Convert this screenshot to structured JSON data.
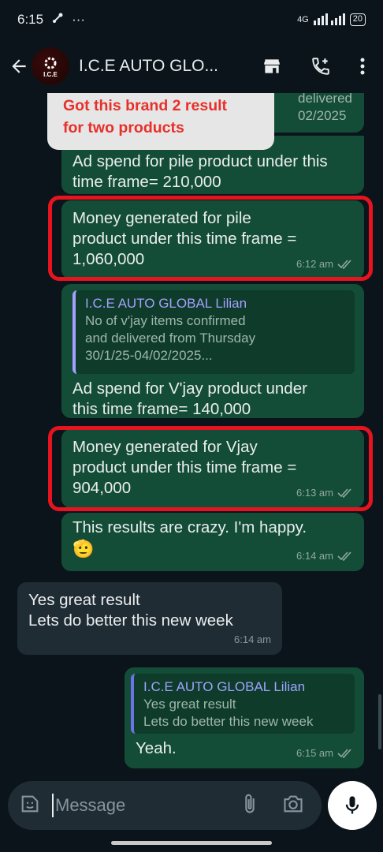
{
  "status_bar": {
    "time": "6:15",
    "network": "4G",
    "battery": "20",
    "dots": "···"
  },
  "header": {
    "title": "I.C.E AUTO GLO...",
    "avatar_text": "I.C.E"
  },
  "annotation": {
    "text_line1": "Got this brand 2 result",
    "text_line2": "for two products",
    "peek_line1": "delivered",
    "peek_line2": "02/2025"
  },
  "messages": [
    {
      "id": "m1",
      "text": "Ad spend for pile product under this time frame= 210,000"
    },
    {
      "id": "m2",
      "text_line1": "Money generated for pile",
      "text_line2": "product under this time frame =",
      "text_line3": "1,060,000",
      "time": "6:12 am"
    },
    {
      "id": "m3",
      "quote_author": "I.C.E AUTO GLOBAL Lilian",
      "quote_line1": "No of v'jay items confirmed",
      "quote_line2": "and delivered from Thursday",
      "quote_line3": "30/1/25-04/02/2025...",
      "text_line1": "Ad spend for V'jay product under",
      "text_line2": "this time frame= 140,000"
    },
    {
      "id": "m4",
      "text_line1": "Money generated for Vjay",
      "text_line2": "product under this time frame =",
      "text_line3": "904,000",
      "time": "6:13 am"
    },
    {
      "id": "m5",
      "text_line1": "This results are crazy. I'm happy.",
      "emoji": "🫡",
      "time": "6:14 am"
    },
    {
      "id": "m6",
      "text_line1": "Yes great result",
      "text_line2": "Lets do better this new week",
      "time": "6:14 am"
    },
    {
      "id": "m7",
      "quote_author": "I.C.E AUTO GLOBAL Lilian",
      "quote_line1": "Yes great result",
      "quote_line2": "Lets do better this new week",
      "text": "Yeah.",
      "time": "6:15 am"
    }
  ],
  "input": {
    "placeholder": "Message"
  }
}
